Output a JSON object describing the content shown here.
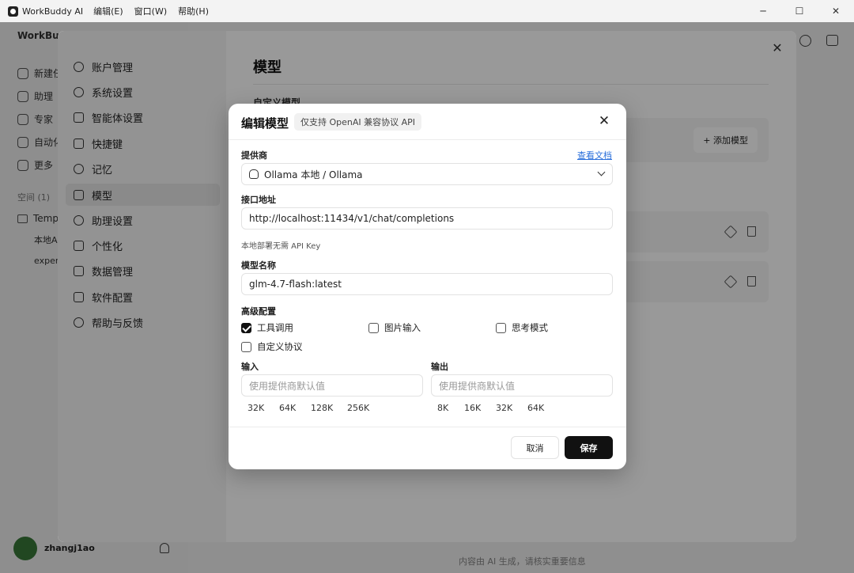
{
  "window": {
    "title": "WorkBuddy AI",
    "menus": [
      "编辑(E)",
      "窗口(W)",
      "帮助(H)"
    ],
    "controls": [
      "─",
      "☐",
      "✕"
    ]
  },
  "background_app": {
    "brand": "WorkBuddy",
    "items": [
      "新建任务",
      "助理",
      "专家",
      "自动化",
      "更多"
    ],
    "space_label": "空间 (1)",
    "folder": "Templ",
    "sub_items": [
      "本地A",
      "expert"
    ],
    "user_name": "zhangj1ao",
    "footer_note": "内容由 AI 生成，请核实重要信息"
  },
  "settings": {
    "nav": [
      {
        "label": "账户管理",
        "icon": "user-icon"
      },
      {
        "label": "系统设置",
        "icon": "gear-icon"
      },
      {
        "label": "智能体设置",
        "icon": "puzzle-icon"
      },
      {
        "label": "快捷键",
        "icon": "keyboard-icon"
      },
      {
        "label": "记忆",
        "icon": "memory-icon"
      },
      {
        "label": "模型",
        "icon": "cube-icon",
        "active": true
      },
      {
        "label": "助理设置",
        "icon": "assistant-icon"
      },
      {
        "label": "个性化",
        "icon": "sparkle-icon"
      },
      {
        "label": "数据管理",
        "icon": "database-icon"
      },
      {
        "label": "软件配置",
        "icon": "code-icon"
      },
      {
        "label": "帮助与反馈",
        "icon": "help-icon"
      }
    ],
    "title": "模型",
    "section": "自定义模型",
    "add_model": "+ 添加模型",
    "close": "✕"
  },
  "modal": {
    "title": "编辑模型",
    "tag": "仅支持 OpenAI 兼容协议 API",
    "close": "✕",
    "provider_label": "提供商",
    "docs_link": "查看文档",
    "provider_value": "Ollama 本地 / Ollama",
    "endpoint_label": "接口地址",
    "endpoint_value": "http://localhost:11434/v1/chat/completions",
    "hint": "本地部署无需 API Key",
    "model_name_label": "模型名称",
    "model_name_value": "glm-4.7-flash:latest",
    "advanced_label": "高级配置",
    "options": [
      {
        "label": "工具调用",
        "checked": true
      },
      {
        "label": "图片输入",
        "checked": false
      },
      {
        "label": "思考模式",
        "checked": false
      },
      {
        "label": "自定义协议",
        "checked": false
      }
    ],
    "input_label": "输入",
    "output_label": "输出",
    "input_placeholder": "使用提供商默认值",
    "output_placeholder": "使用提供商默认值",
    "input_presets": [
      "32K",
      "64K",
      "128K",
      "256K"
    ],
    "output_presets": [
      "8K",
      "16K",
      "32K",
      "64K"
    ],
    "cancel": "取消",
    "save": "保存"
  }
}
